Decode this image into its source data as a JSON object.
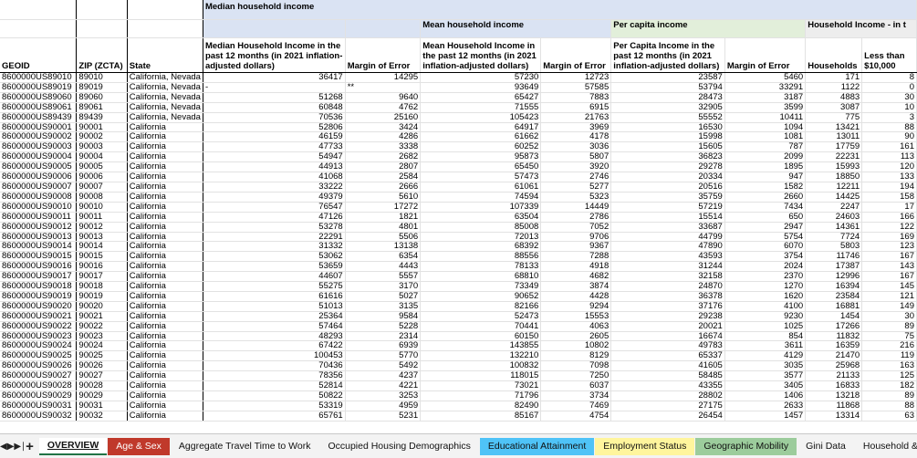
{
  "groups": {
    "median": "Median household income",
    "mean": "Mean household income",
    "per_capita": "Per capita income",
    "hh_income": "Household Income - in t"
  },
  "headers": {
    "geoid": "GEOID",
    "zip": "ZIP (ZCTA)",
    "state": "State",
    "median_income": "Median Household Income in the past 12 months (in 2021 inflation-adjusted dollars)",
    "moe": "Margin of Error",
    "mean_income": "Mean Household Income in the past 12 months (in 2021 inflation-adjusted dollars)",
    "per_capita_income": "Per Capita Income in the past 12 months (in 2021 inflation-adjusted dollars)",
    "households": "Households",
    "less_10k": "Less than $10,000"
  },
  "rows": [
    [
      "8600000US89010",
      "89010",
      "California, Nevada",
      "36417",
      "14295",
      "57230",
      "12723",
      "23587",
      "5460",
      "171",
      "8"
    ],
    [
      "8600000US89019",
      "89019",
      "California, Nevada",
      "-",
      "**",
      "93649",
      "57585",
      "53794",
      "33291",
      "1122",
      "0"
    ],
    [
      "8600000US89060",
      "89060",
      "California, Nevada",
      "51268",
      "9640",
      "65427",
      "7883",
      "28473",
      "3187",
      "4883",
      "30"
    ],
    [
      "8600000US89061",
      "89061",
      "California, Nevada",
      "60848",
      "4762",
      "71555",
      "6915",
      "32905",
      "3599",
      "3087",
      "10"
    ],
    [
      "8600000US89439",
      "89439",
      "California, Nevada",
      "70536",
      "25160",
      "105423",
      "21763",
      "55552",
      "10411",
      "775",
      "3"
    ],
    [
      "8600000US90001",
      "90001",
      "California",
      "52806",
      "3424",
      "64917",
      "3969",
      "16530",
      "1094",
      "13421",
      "88"
    ],
    [
      "8600000US90002",
      "90002",
      "California",
      "46159",
      "4286",
      "61662",
      "4178",
      "15998",
      "1081",
      "13011",
      "90"
    ],
    [
      "8600000US90003",
      "90003",
      "California",
      "47733",
      "3338",
      "60252",
      "3036",
      "15605",
      "787",
      "17759",
      "161"
    ],
    [
      "8600000US90004",
      "90004",
      "California",
      "54947",
      "2682",
      "95873",
      "5807",
      "36823",
      "2099",
      "22231",
      "113"
    ],
    [
      "8600000US90005",
      "90005",
      "California",
      "44913",
      "2807",
      "65450",
      "3920",
      "29278",
      "1895",
      "15993",
      "120"
    ],
    [
      "8600000US90006",
      "90006",
      "California",
      "41068",
      "2584",
      "57473",
      "2746",
      "20334",
      "947",
      "18850",
      "133"
    ],
    [
      "8600000US90007",
      "90007",
      "California",
      "33222",
      "2666",
      "61061",
      "5277",
      "20516",
      "1582",
      "12211",
      "194"
    ],
    [
      "8600000US90008",
      "90008",
      "California",
      "49379",
      "5610",
      "74594",
      "5323",
      "35759",
      "2660",
      "14425",
      "158"
    ],
    [
      "8600000US90010",
      "90010",
      "California",
      "76547",
      "17272",
      "107339",
      "14449",
      "57219",
      "7434",
      "2247",
      "17"
    ],
    [
      "8600000US90011",
      "90011",
      "California",
      "47126",
      "1821",
      "63504",
      "2786",
      "15514",
      "650",
      "24603",
      "166"
    ],
    [
      "8600000US90012",
      "90012",
      "California",
      "53278",
      "4801",
      "85008",
      "7052",
      "33687",
      "2947",
      "14361",
      "122"
    ],
    [
      "8600000US90013",
      "90013",
      "California",
      "22291",
      "5506",
      "72013",
      "9706",
      "44799",
      "5754",
      "7724",
      "169"
    ],
    [
      "8600000US90014",
      "90014",
      "California",
      "31332",
      "13138",
      "68392",
      "9367",
      "47890",
      "6070",
      "5803",
      "123"
    ],
    [
      "8600000US90015",
      "90015",
      "California",
      "53062",
      "6354",
      "88556",
      "7288",
      "43593",
      "3754",
      "11746",
      "167"
    ],
    [
      "8600000US90016",
      "90016",
      "California",
      "53659",
      "4443",
      "78133",
      "4918",
      "31244",
      "2024",
      "17387",
      "143"
    ],
    [
      "8600000US90017",
      "90017",
      "California",
      "44607",
      "5557",
      "68810",
      "4682",
      "32158",
      "2370",
      "12996",
      "167"
    ],
    [
      "8600000US90018",
      "90018",
      "California",
      "55275",
      "3170",
      "73349",
      "3874",
      "24870",
      "1270",
      "16394",
      "145"
    ],
    [
      "8600000US90019",
      "90019",
      "California",
      "61616",
      "5027",
      "90652",
      "4428",
      "36378",
      "1620",
      "23584",
      "121"
    ],
    [
      "8600000US90020",
      "90020",
      "California",
      "51013",
      "3135",
      "82166",
      "9294",
      "37176",
      "4100",
      "16881",
      "149"
    ],
    [
      "8600000US90021",
      "90021",
      "California",
      "25364",
      "9584",
      "52473",
      "15553",
      "29238",
      "9230",
      "1454",
      "30"
    ],
    [
      "8600000US90022",
      "90022",
      "California",
      "57464",
      "5228",
      "70441",
      "4063",
      "20021",
      "1025",
      "17266",
      "89"
    ],
    [
      "8600000US90023",
      "90023",
      "California",
      "48293",
      "2314",
      "60150",
      "2605",
      "16674",
      "854",
      "11832",
      "75"
    ],
    [
      "8600000US90024",
      "90024",
      "California",
      "67422",
      "6939",
      "143855",
      "10802",
      "49783",
      "3611",
      "16359",
      "216"
    ],
    [
      "8600000US90025",
      "90025",
      "California",
      "100453",
      "5770",
      "132210",
      "8129",
      "65337",
      "4129",
      "21470",
      "119"
    ],
    [
      "8600000US90026",
      "90026",
      "California",
      "70436",
      "5492",
      "100832",
      "7098",
      "41605",
      "3035",
      "25968",
      "163"
    ],
    [
      "8600000US90027",
      "90027",
      "California",
      "78356",
      "4237",
      "118015",
      "7250",
      "58485",
      "3577",
      "21133",
      "125"
    ],
    [
      "8600000US90028",
      "90028",
      "California",
      "52814",
      "4221",
      "73021",
      "6037",
      "43355",
      "3405",
      "16833",
      "182"
    ],
    [
      "8600000US90029",
      "90029",
      "California",
      "50822",
      "3253",
      "71796",
      "3734",
      "28802",
      "1406",
      "13218",
      "89"
    ],
    [
      "8600000US90031",
      "90031",
      "California",
      "53319",
      "4959",
      "82490",
      "7469",
      "27175",
      "2633",
      "11868",
      "88"
    ],
    [
      "8600000US90032",
      "90032",
      "California",
      "65761",
      "5231",
      "85167",
      "4754",
      "26454",
      "1457",
      "13314",
      "63"
    ]
  ],
  "tabs": [
    {
      "label": "OVERVIEW",
      "color": "#ffffff",
      "text": "#111111"
    },
    {
      "label": "Age & Sex",
      "color": "#c0392b",
      "text": "#ffffff"
    },
    {
      "label": "Aggregate Travel Time to Work",
      "color": "#f3f3f3",
      "text": "#111111"
    },
    {
      "label": "Occupied Housing Demographics",
      "color": "#f3f3f3",
      "text": "#111111"
    },
    {
      "label": "Educational Attainment",
      "color": "#4fc3f7",
      "text": "#111111"
    },
    {
      "label": "Employment Status",
      "color": "#fff59d",
      "text": "#111111"
    },
    {
      "label": "Geographic Mobility",
      "color": "#9ccc9c",
      "text": "#111111"
    },
    {
      "label": "Gini Data",
      "color": "#f3f3f3",
      "text": "#111111"
    },
    {
      "label": "Household & Families",
      "color": "#f3f3f3",
      "text": "#111111"
    }
  ],
  "active_tab": 0,
  "icons": {
    "first": "nav-prev-icon",
    "next": "nav-next-icon",
    "last": "nav-last-icon",
    "add": "add-sheet-icon"
  }
}
